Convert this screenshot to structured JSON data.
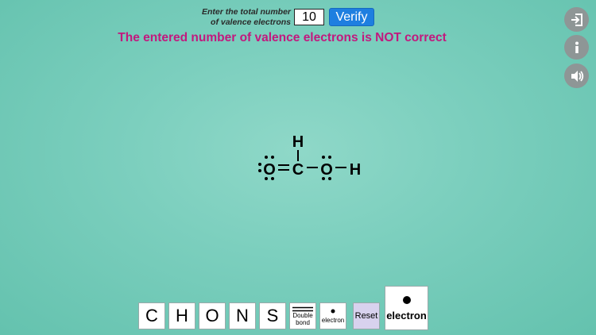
{
  "header": {
    "prompt_label": "Enter the total number of valence electrons",
    "valence_value": "10",
    "verify_label": "Verify",
    "result_message": "The entered number of valence electrons is NOT correct"
  },
  "sidebar": {
    "buttons": [
      {
        "name": "exit",
        "icon": "exit-icon"
      },
      {
        "name": "info",
        "icon": "info-icon"
      },
      {
        "name": "sound",
        "icon": "speaker-icon"
      }
    ]
  },
  "molecule": {
    "atoms": {
      "h_top": "H",
      "o_left": "O",
      "c_center": "C",
      "o_right": "O",
      "h_right": "H"
    }
  },
  "toolbar": {
    "letters": [
      "C",
      "H",
      "O",
      "N",
      "S"
    ],
    "double_bond_label_1": "Double",
    "double_bond_label_2": "bond",
    "electron_small_label": "electron",
    "reset_label": "Reset",
    "electron_big_label": "electron"
  },
  "colors": {
    "message": "#c2187e",
    "verify_button": "#1e7fe0",
    "reset_tile": "#d8d2ee",
    "side_buttons": "#8e9696"
  }
}
